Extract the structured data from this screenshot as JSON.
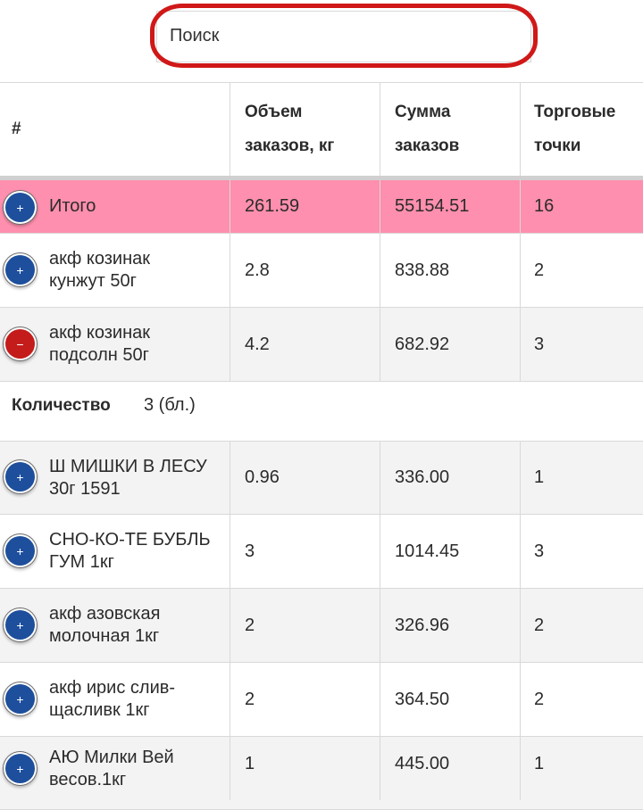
{
  "search": {
    "placeholder": "Поиск"
  },
  "table": {
    "headers": {
      "num": "#",
      "volume": [
        "Объем",
        "заказов, кг"
      ],
      "sum": [
        "Сумма",
        "заказов"
      ],
      "points": [
        "Торговые",
        "точки"
      ]
    },
    "total": {
      "name": "Итого",
      "volume": "261.59",
      "sum": "55154.51",
      "points": "16",
      "toggle": "+"
    },
    "rows_top": [
      {
        "name": [
          "акф козинак",
          "кунжут 50г"
        ],
        "volume": "2.8",
        "sum": "838.88",
        "points": "2",
        "toggle": "+",
        "expanded": false
      },
      {
        "name": [
          "акф козинак",
          "подсолн 50г"
        ],
        "volume": "4.2",
        "sum": "682.92",
        "points": "3",
        "toggle": "−",
        "expanded": true
      }
    ],
    "quantity_detail": {
      "label": "Количество",
      "value": "3 (бл.)"
    },
    "rows_bottom": [
      {
        "name": [
          "Ш МИШКИ В ЛЕСУ",
          "30г 1591"
        ],
        "volume": "0.96",
        "sum": "336.00",
        "points": "1",
        "toggle": "+"
      },
      {
        "name": [
          "СНО-КО-ТЕ БУБЛЬ",
          "ГУМ 1кг"
        ],
        "volume": "3",
        "sum": "1014.45",
        "points": "3",
        "toggle": "+"
      },
      {
        "name": [
          "акф азовская",
          "молочная 1кг"
        ],
        "volume": "2",
        "sum": "326.96",
        "points": "2",
        "toggle": "+"
      },
      {
        "name": [
          "акф ирис слив-",
          "щасливк 1кг"
        ],
        "volume": "2",
        "sum": "364.50",
        "points": "2",
        "toggle": "+"
      },
      {
        "name": [
          "АЮ Милки Вей",
          "весов.1кг"
        ],
        "volume": "1",
        "sum": "445.00",
        "points": "1",
        "toggle": "+"
      }
    ]
  },
  "colors": {
    "total_row": "#ff8fae",
    "toggle_plus": "#1d4f9c",
    "toggle_minus": "#c41b1b",
    "search_highlight": "#d01818"
  }
}
